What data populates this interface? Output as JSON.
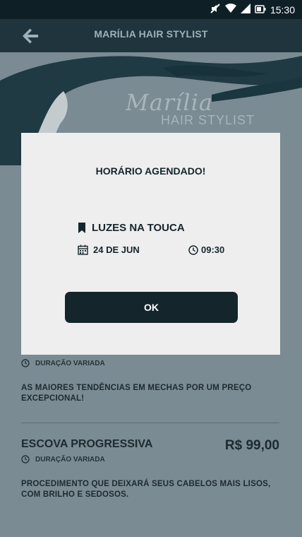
{
  "status_bar": {
    "time": "15:30"
  },
  "app_bar": {
    "title": "MARÍLIA HAIR STYLIST"
  },
  "brand": {
    "script": "Marília",
    "sub": "HAIR STYLIST"
  },
  "services": [
    {
      "duration": "DURAÇÃO VARIADA",
      "description": "AS MAIORES TENDÊNCIAS EM MECHAS POR UM PREÇO EXCEPCIONAL!"
    },
    {
      "name": "ESCOVA PROGRESSIVA",
      "price": "R$ 99,00",
      "duration": "DURAÇÃO VARIADA",
      "description": "PROCEDIMENTO QUE DEIXARÁ SEUS CABELOS MAIS LISOS, COM BRILHO E SEDOSOS."
    }
  ],
  "dialog": {
    "title": "HORÁRIO AGENDADO!",
    "service": "LUZES NA TOUCA",
    "date": "24 DE JUN",
    "time": "09:30",
    "ok_label": "OK"
  },
  "colors": {
    "dark": "#15252c",
    "app_bar": "#1f343d",
    "backdrop": "#7b8b93",
    "dialog_bg": "#eeeeee"
  }
}
